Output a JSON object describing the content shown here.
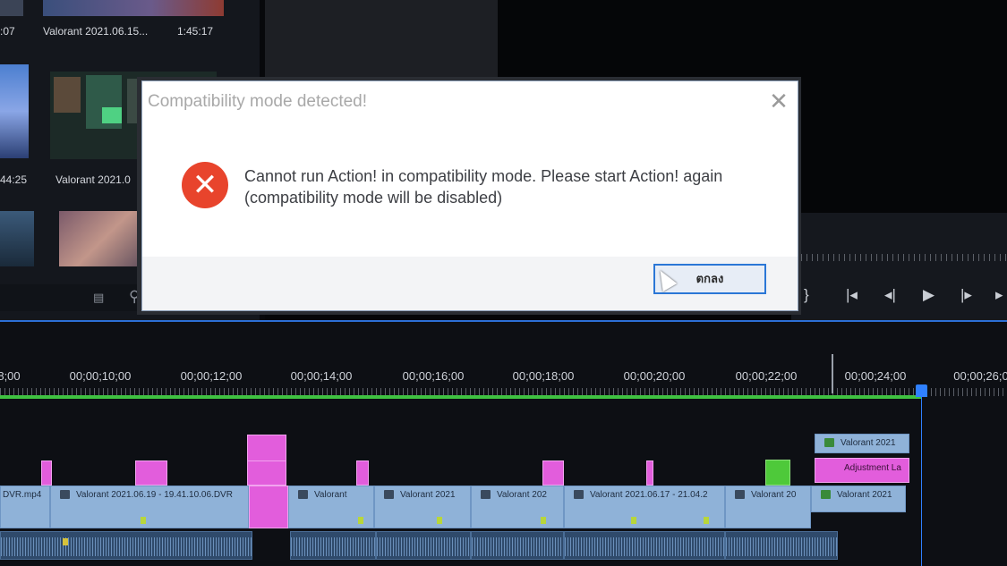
{
  "project_bin": {
    "clips": [
      {
        "name": "Valorant 2021.06.15...",
        "duration": "1:45:17"
      },
      {
        "name": "Valorant 2021.0",
        "duration": ""
      }
    ],
    "partial_durations": [
      ":07",
      "44:25"
    ]
  },
  "dialog": {
    "title": "Compatibility mode detected!",
    "message": "Cannot run Action! in compatibility mode. Please start Action! again (compatibility mode will be disabled)",
    "ok_label": "ตกลง",
    "close_symbol": "✕",
    "error_symbol": "✕"
  },
  "timeline": {
    "timecodes": [
      "8;00",
      "00;00;10;00",
      "00;00;12;00",
      "00;00;14;00",
      "00;00;16;00",
      "00;00;18;00",
      "00;00;20;00",
      "00;00;22;00",
      "00;00;24;00",
      "00;00;26;0"
    ],
    "v_clips": [
      "DVR.mp4",
      "Valorant 2021.06.19 - 19.41.10.06.DVR",
      "Valorant",
      "Valorant 2021",
      "Valorant 202",
      "Valorant 2021.06.17 - 21.04.2",
      "Valorant 20",
      "Valorant 2021"
    ],
    "v3_clip": "Valorant 2021",
    "adjustment_layer": "Adjustment La"
  },
  "colors": {
    "accent": "#2b77d6",
    "error": "#e8442c",
    "work_area": "#3fc241",
    "adjustment": "#e25ddc",
    "playhead": "#2f80ff"
  }
}
